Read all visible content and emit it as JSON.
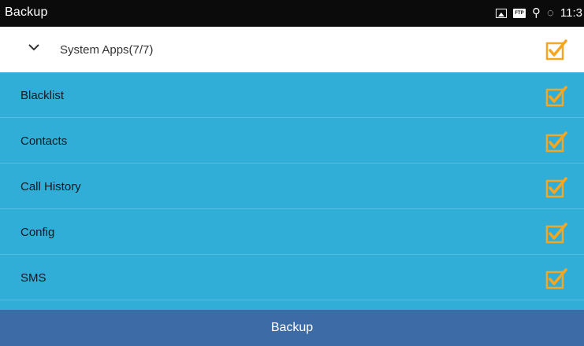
{
  "status_bar": {
    "title": "Backup",
    "icons": [
      "image-icon",
      "ftp-icon",
      "usb-icon",
      "sync-icon"
    ],
    "ftp_text": "FTP",
    "clock": "11:3"
  },
  "group": {
    "label": "System Apps(7/7)",
    "checked": true
  },
  "items": [
    {
      "label": "Blacklist",
      "checked": true
    },
    {
      "label": "Contacts",
      "checked": true
    },
    {
      "label": "Call History",
      "checked": true
    },
    {
      "label": "Config",
      "checked": true
    },
    {
      "label": "SMS",
      "checked": true
    }
  ],
  "actions": {
    "backup_label": "Backup"
  },
  "colors": {
    "status_bar_bg": "#0b0b0b",
    "list_bg": "#31aed8",
    "button_bg": "#3d6ba6",
    "checkbox_orange": "#f5a623"
  }
}
